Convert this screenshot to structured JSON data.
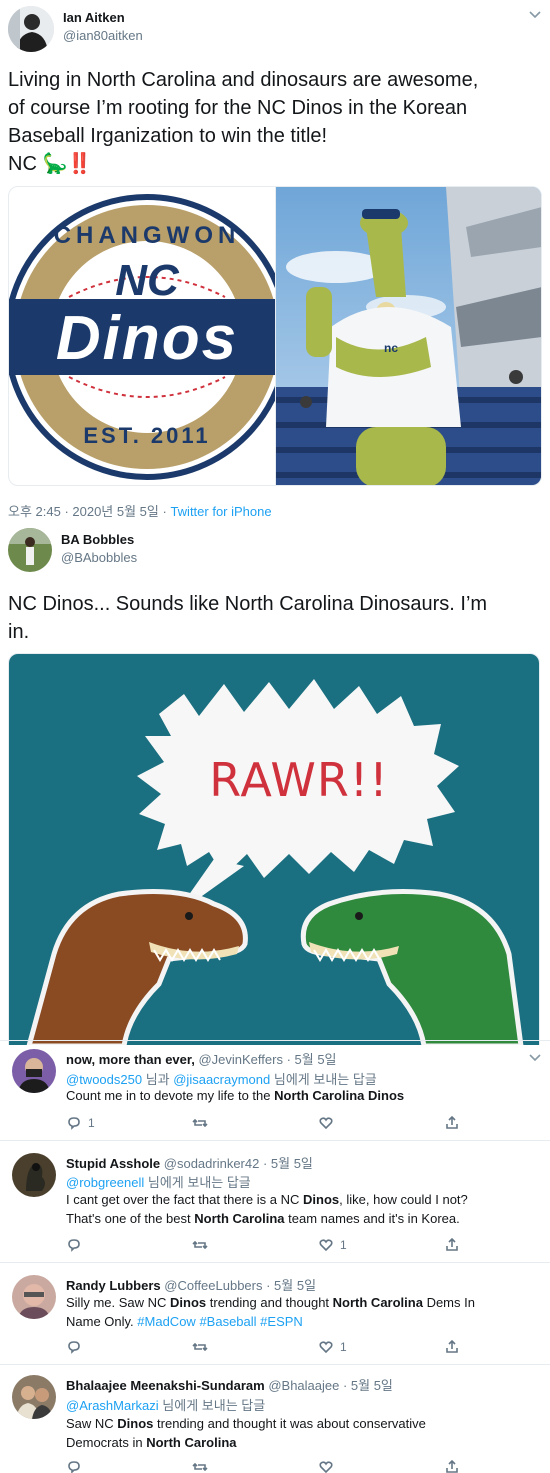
{
  "tweet1": {
    "name": "Ian Aitken",
    "handle": "@ian80aitken",
    "text_line1": "Living in North Carolina and dinosaurs are awesome,",
    "text_line2": "of course I’m rooting for the NC Dinos in the Korean",
    "text_line3": "Baseball Irganization to win the title!",
    "text_line4": "NC 🦕‼️",
    "logo": {
      "top_text": "CHANGWON",
      "mark": "NC",
      "word": "Dinos",
      "est": "EST. 2011"
    },
    "timestamp": "오후 2:45 · 2020년 5월 5일 · ",
    "source": "Twitter for iPhone"
  },
  "tweet2": {
    "name": "BA Bobbles",
    "handle": "@BAbobbles",
    "text_line1": "NC Dinos... Sounds like North Carolina Dinosaurs. I’m",
    "text_line2": "in.",
    "bubble_text": "RAWR!!"
  },
  "replies": [
    {
      "name": "now, more than ever,",
      "handle": "@JevinKeffers · 5월 5일",
      "replying_to": [
        "@twoods250",
        " 님과 ",
        "@jisaacraymond",
        " 님에게 보내는 답글"
      ],
      "body": [
        "Count me in to devote my life to the ",
        "North Carolina Dinos"
      ],
      "reply_count": "1",
      "like_count": ""
    },
    {
      "name": "Stupid Asshole",
      "handle": "@sodadrinker42 · 5월 5일",
      "replying_to": [
        "@robgreenell",
        " 님에게 보내는 답글"
      ],
      "body": [
        "I cant get over the fact that there is a NC ",
        "Dinos",
        ", like, how could I not?",
        "That's one of the best ",
        "North Carolina",
        " team names and it's in Korea."
      ],
      "reply_count": "",
      "like_count": "1"
    },
    {
      "name": "Randy Lubbers",
      "handle": "@CoffeeLubbers · 5월 5일",
      "body": [
        "Silly me. Saw NC ",
        "Dinos",
        " trending and thought ",
        "North Carolina",
        " Dems In",
        "Name Only. ",
        "#MadCow",
        " ",
        "#Baseball",
        " ",
        "#ESPN"
      ],
      "reply_count": "",
      "like_count": "1"
    },
    {
      "name": "Bhalaajee Meenakshi-Sundaram",
      "handle": "@Bhalaajee · 5월 5일",
      "replying_to": [
        "@ArashMarkazi",
        " 님에게 보내는 답글"
      ],
      "body": [
        "Saw NC ",
        "Dinos",
        " trending and thought it was about conservative",
        "Democrats in ",
        "North Carolina"
      ],
      "reply_count": "",
      "like_count": ""
    }
  ],
  "icons": {
    "chevron": "chevron-down-icon",
    "reply": "reply-icon",
    "retweet": "retweet-icon",
    "like": "heart-icon",
    "share": "share-icon"
  },
  "colors": {
    "link": "#1da1f2",
    "muted": "#657786",
    "navy": "#1b3a6b",
    "gold": "#b9a06a",
    "teal": "#1a6f80",
    "rawr_red": "#d0323d"
  }
}
